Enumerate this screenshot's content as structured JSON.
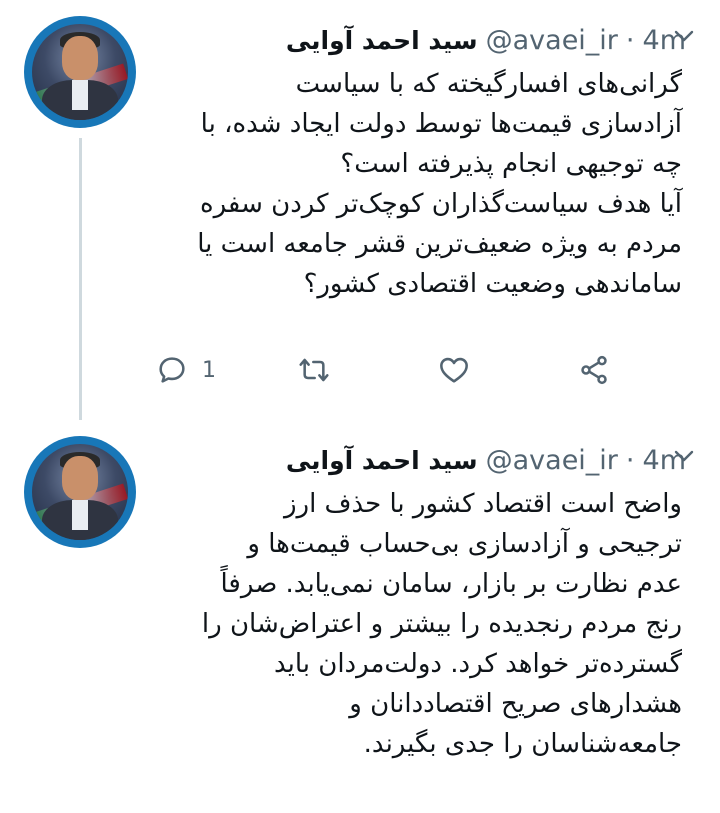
{
  "tweets": [
    {
      "author": {
        "display_name": "سید احمد آوایی",
        "handle": "@avaei_ir",
        "separator": "·",
        "time": "4m"
      },
      "text": "گرانی‌های افسارگیخته که با سیاست\nآزادسازی قیمت‌ها توسط دولت ایجاد شده، با\nچه توجیهی انجام پذیرفته است؟\nآیا هدف سیاست‌گذاران کوچک‌تر کردن سفره\nمردم به ویژه ضعیف‌ترین قشر جامعه است یا\nساماندهی وضعیت اقتصادی کشور؟",
      "actions": {
        "reply_icon": "reply-icon",
        "reply_count": "1",
        "retweet_icon": "retweet-icon",
        "like_icon": "heart-icon",
        "share_icon": "share-icon"
      },
      "has_thread_line": true
    },
    {
      "author": {
        "display_name": "سید احمد آوایی",
        "handle": "@avaei_ir",
        "separator": "·",
        "time": "4m"
      },
      "text": "واضح است اقتصاد کشور با حذف ارز\nترجیحی و آزادسازی بی‌حساب قیمت‌ها و\nعدم نظارت بر بازار، سامان نمی‌یابد. صرفاً\nرنج مردم رنجدیده را بیشتر و اعتراض‌شان را\nگسترده‌تر خواهد کرد. دولت‌مردان باید\nهشدارهای صریح اقتصاددانان و\nجامعه‌شناسان را جدی بگیرند."
    }
  ],
  "colors": {
    "text": "#0f1419",
    "secondary": "#536471",
    "thread_line": "#cfd9de",
    "avatar_ring": "#1877b8"
  },
  "icons": {
    "menu": "chevron-down-icon",
    "avatar": "avatar"
  }
}
